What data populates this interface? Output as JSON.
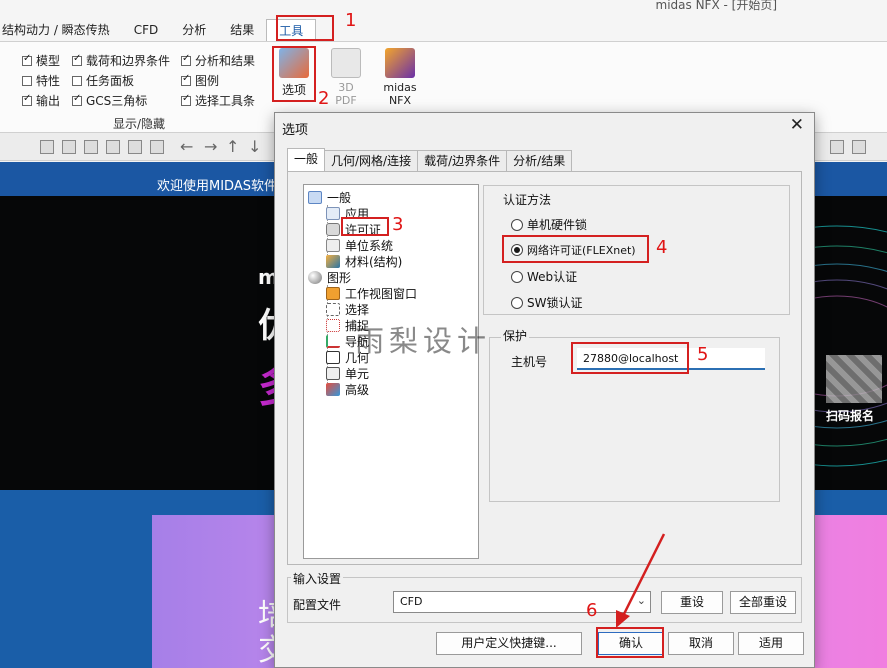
{
  "app_title": "midas NFX - [开始页]",
  "menu_tabs": [
    "结构动力 / 瞬态传热",
    "CFD",
    "分析",
    "结果",
    "工具"
  ],
  "ribbon": {
    "checkboxes": [
      {
        "label": "模型",
        "checked": true
      },
      {
        "label": "特性",
        "checked": false
      },
      {
        "label": "输出",
        "checked": true
      },
      {
        "label": "载荷和边界条件",
        "checked": true
      },
      {
        "label": "任务面板",
        "checked": false
      },
      {
        "label": "GCS三角标",
        "checked": true
      },
      {
        "label": "分析和结果",
        "checked": true
      },
      {
        "label": "图例",
        "checked": true
      },
      {
        "label": "选择工具条",
        "checked": true
      }
    ],
    "group_label": "显示/隐藏",
    "buttons": {
      "options": "选项",
      "pdf3d_line1": "3D",
      "pdf3d_line2": "PDF",
      "nfx_line1": "midas",
      "nfx_line2": "NFX"
    }
  },
  "background": {
    "welcome": "欢迎使用MIDAS软件",
    "hero_small": "m",
    "hero_big_1": "优",
    "hero_big_2": "多",
    "banner_text_1": "培",
    "banner_text_2": "交",
    "qr_label": "扫码报名"
  },
  "dialog": {
    "title": "选项",
    "close": "✕",
    "tabs": [
      "一般",
      "几何/网格/连接",
      "载荷/边界条件",
      "分析/结果"
    ],
    "tree": {
      "root_general": "一般",
      "app": "应用",
      "license": "许可证",
      "unit": "单位系统",
      "material": "材料(结构)",
      "root_graphics": "图形",
      "viewport": "工作视图窗口",
      "select": "选择",
      "snap": "捕捉",
      "navigate": "导航",
      "geometry": "几何",
      "element": "单元",
      "advanced": "高级"
    },
    "auth_title": "认证方法",
    "auth_options": [
      {
        "label": "单机硬件锁",
        "selected": false
      },
      {
        "label": "网络许可证(FLEXnet)",
        "selected": true
      },
      {
        "label": "Web认证",
        "selected": false
      },
      {
        "label": "SW锁认证",
        "selected": false
      }
    ],
    "protect_title": "保护",
    "host_label": "主机号",
    "host_value": "27880@localhost",
    "input_settings_title": "输入设置",
    "profile_label": "配置文件",
    "profile_value": "CFD",
    "reset": "重设",
    "reset_all": "全部重设",
    "shortcuts": "用户定义快捷键...",
    "ok": "确认",
    "cancel": "取消",
    "apply": "适用"
  },
  "annotations": {
    "n1": "1",
    "n2": "2",
    "n3": "3",
    "n4": "4",
    "n5": "5",
    "n6": "6",
    "watermark": "雨梨设计",
    "annotation_color": "#d42020"
  }
}
